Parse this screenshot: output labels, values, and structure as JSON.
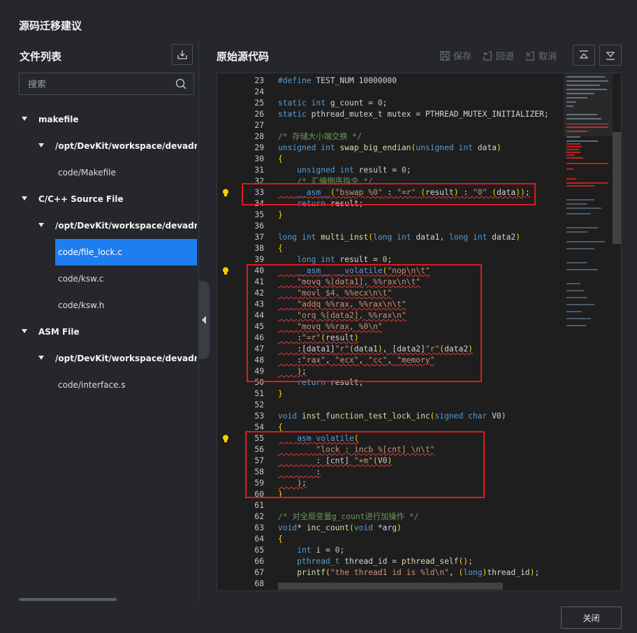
{
  "dialog": {
    "title": "源码迁移建议",
    "close_label": "关闭"
  },
  "left": {
    "title": "文件列表",
    "search_placeholder": "搜索",
    "tree": [
      {
        "label": "makefile",
        "level": 0,
        "kind": "group"
      },
      {
        "label": "/opt/DevKit/workspace/devadmin/p",
        "level": 1,
        "kind": "folder"
      },
      {
        "label": "code/Makefile",
        "level": 2,
        "kind": "file"
      },
      {
        "label": "C/C++ Source File",
        "level": 0,
        "kind": "group"
      },
      {
        "label": "/opt/DevKit/workspace/devadmin/p",
        "level": 1,
        "kind": "folder"
      },
      {
        "label": "code/file_lock.c",
        "level": 2,
        "kind": "file",
        "selected": true
      },
      {
        "label": "code/ksw.c",
        "level": 2,
        "kind": "file"
      },
      {
        "label": "code/ksw.h",
        "level": 2,
        "kind": "file"
      },
      {
        "label": "ASM File",
        "level": 0,
        "kind": "group"
      },
      {
        "label": "/opt/DevKit/workspace/devadmin/p",
        "level": 1,
        "kind": "folder"
      },
      {
        "label": "code/interface.s",
        "level": 2,
        "kind": "file"
      }
    ]
  },
  "right": {
    "title": "原始源代码",
    "toolbar": {
      "save": "保存",
      "rollback": "回退",
      "cancel": "取消"
    }
  },
  "code": {
    "lines": [
      {
        "n": "23",
        "t": "#define TEST_NUM 10000000"
      },
      {
        "n": "24",
        "t": ""
      },
      {
        "n": "25",
        "t": "static int g_count = 0;"
      },
      {
        "n": "26",
        "t": "static pthread_mutex_t mutex = PTHREAD_MUTEX_INITIALIZER;"
      },
      {
        "n": "27",
        "t": ""
      },
      {
        "n": "28",
        "t": "/* 存储大小端交换 */"
      },
      {
        "n": "29",
        "t": "unsigned int swap_big_endian(unsigned int data)"
      },
      {
        "n": "30",
        "t": "{"
      },
      {
        "n": "31",
        "t": "    unsigned int result = 0;"
      },
      {
        "n": "32",
        "t": "    /* 汇编倒序指令 */"
      },
      {
        "n": "33",
        "t": "    __asm__(\"bswap %0\" : \"=r\" (result) : \"0\" (data));"
      },
      {
        "n": "34",
        "t": "    return result;"
      },
      {
        "n": "35",
        "t": "}"
      },
      {
        "n": "36",
        "t": ""
      },
      {
        "n": "37",
        "t": "long int multi_inst(long int data1, long int data2)"
      },
      {
        "n": "38",
        "t": "{"
      },
      {
        "n": "39",
        "t": "    long int result = 0;"
      },
      {
        "n": "40",
        "t": "    __asm__ __volatile(\"nop\\n\\t\""
      },
      {
        "n": "41",
        "t": "    \"movq %[data1], %%rax\\n\\t\""
      },
      {
        "n": "42",
        "t": "    \"movl $4, %%ecx\\n\\t\""
      },
      {
        "n": "43",
        "t": "    \"addq %%rax, %%rax\\n\\t\""
      },
      {
        "n": "44",
        "t": "    \"orq %[data2], %%rax\\n\""
      },
      {
        "n": "45",
        "t": "    \"movq %%rax, %0\\n\""
      },
      {
        "n": "46",
        "t": "    :\"=r\"(result)"
      },
      {
        "n": "47",
        "t": "    :[data1]\"r\"(data1), [data2]\"r\"(data2)"
      },
      {
        "n": "48",
        "t": "    :\"rax\", \"ecx\", \"cc\", \"memory\""
      },
      {
        "n": "49",
        "t": "    );"
      },
      {
        "n": "50",
        "t": "    return result;"
      },
      {
        "n": "51",
        "t": "}"
      },
      {
        "n": "52",
        "t": ""
      },
      {
        "n": "53",
        "t": "void inst_function_test_lock_inc(signed char V0)"
      },
      {
        "n": "54",
        "t": "{"
      },
      {
        "n": "55",
        "t": "    asm volatile("
      },
      {
        "n": "56",
        "t": "        \"lock ; incb %[cnt] \\n\\t\""
      },
      {
        "n": "57",
        "t": "        : [cnt] \"+m\"(V0)"
      },
      {
        "n": "58",
        "t": "        :"
      },
      {
        "n": "59",
        "t": "    );"
      },
      {
        "n": "60",
        "t": "}"
      },
      {
        "n": "61",
        "t": ""
      },
      {
        "n": "62",
        "t": "/* 对全局变量g_count进行加操作 */"
      },
      {
        "n": "63",
        "t": "void* inc_count(void *arg)"
      },
      {
        "n": "64",
        "t": "{"
      },
      {
        "n": "65",
        "t": "    int i = 0;"
      },
      {
        "n": "66",
        "t": "    pthread_t thread_id = pthread_self();"
      },
      {
        "n": "67",
        "t": "    printf(\"the thread1 id is %ld\\n\", (long)thread_id);"
      },
      {
        "n": "68",
        "t": ""
      }
    ],
    "bulb_lines": [
      "33",
      "40",
      "55"
    ],
    "colors": {
      "keyword": "#569cd6",
      "comment": "#6a9955",
      "string": "#ce9178",
      "function": "#dcdcaa",
      "number": "#b5cea8",
      "selection": "#1e7ef0",
      "highlight_box": "#e0191e"
    }
  }
}
